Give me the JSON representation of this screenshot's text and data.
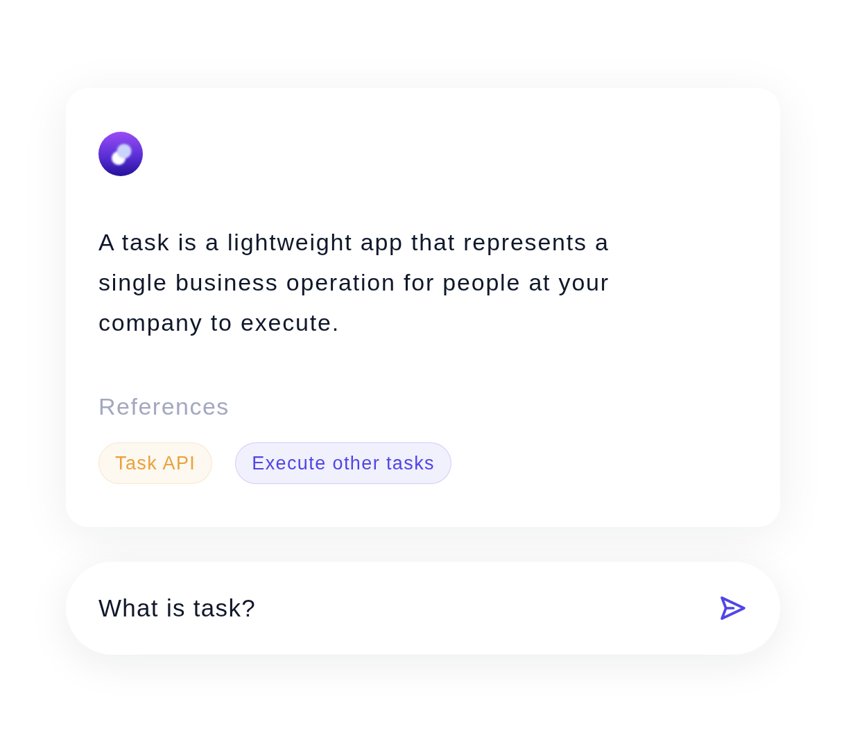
{
  "answer_card": {
    "text": "A task is a lightweight app that represents a single business operation for people at your company to execute."
  },
  "references": {
    "heading": "References",
    "items": [
      {
        "label": "Task API",
        "color": "#e9a23b"
      },
      {
        "label": "Execute other tasks",
        "color": "#5046e5"
      }
    ]
  },
  "message_input": {
    "value": "What is task?"
  }
}
